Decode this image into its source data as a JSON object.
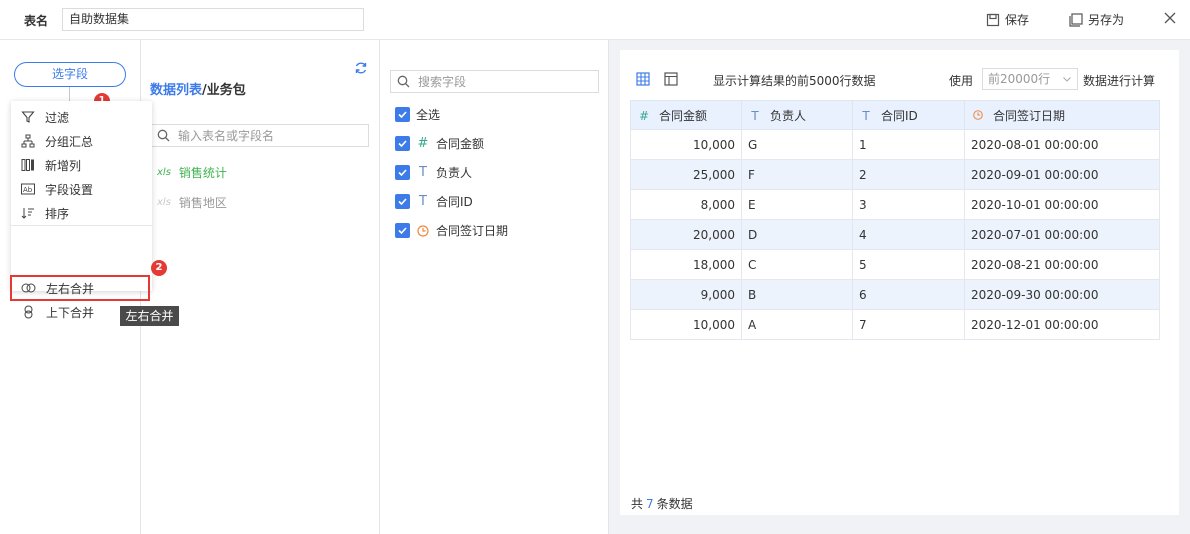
{
  "topbar": {
    "table_name_label": "表名",
    "table_name_value": "自助数据集",
    "save_label": "保存",
    "save_as_label": "另存为"
  },
  "left": {
    "select_field_label": "选字段",
    "plus_label": "+",
    "badge1": "1",
    "badge2": "2",
    "menu": [
      {
        "label": "过滤",
        "icon": "filter-icon"
      },
      {
        "label": "分组汇总",
        "icon": "group-icon"
      },
      {
        "label": "新增列",
        "icon": "add-column-icon"
      },
      {
        "label": "字段设置",
        "icon": "field-settings-icon"
      },
      {
        "label": "排序",
        "icon": "sort-icon"
      },
      {
        "label": "左右合并",
        "icon": "merge-horizontal-icon"
      },
      {
        "label": "上下合并",
        "icon": "merge-vertical-icon"
      }
    ],
    "tooltip": "左右合并"
  },
  "datalist": {
    "title_highlight": "数据列表",
    "title_rest": "/业务包",
    "search_placeholder": "输入表名或字段名",
    "tables": [
      {
        "name": "销售统计",
        "active": true
      },
      {
        "name": "销售地区",
        "active": false
      }
    ],
    "xls_label": "xls"
  },
  "fields": {
    "search_placeholder": "搜索字段",
    "select_all": "全选",
    "items": [
      {
        "name": "合同金额",
        "type": "#"
      },
      {
        "name": "负责人",
        "type": "T"
      },
      {
        "name": "合同ID",
        "type": "T"
      },
      {
        "name": "合同签订日期",
        "type": "date"
      }
    ]
  },
  "preview": {
    "info_text": "显示计算结果的前5000行数据",
    "use_label": "使用",
    "rows_select": "前20000行",
    "compute_label": "数据进行计算",
    "columns": [
      {
        "name": "合同金额",
        "type": "#"
      },
      {
        "name": "负责人",
        "type": "T"
      },
      {
        "name": "合同ID",
        "type": "T"
      },
      {
        "name": "合同签订日期",
        "type": "date"
      }
    ],
    "rows": [
      [
        "10,000",
        "G",
        "1",
        "2020-08-01 00:00:00"
      ],
      [
        "25,000",
        "F",
        "2",
        "2020-09-01 00:00:00"
      ],
      [
        "8,000",
        "E",
        "3",
        "2020-10-01 00:00:00"
      ],
      [
        "20,000",
        "D",
        "4",
        "2020-07-01 00:00:00"
      ],
      [
        "18,000",
        "C",
        "5",
        "2020-08-21 00:00:00"
      ],
      [
        "9,000",
        "B",
        "6",
        "2020-09-30 00:00:00"
      ],
      [
        "10,000",
        "A",
        "7",
        "2020-12-01 00:00:00"
      ]
    ],
    "footer_prefix": "共",
    "footer_count": "7",
    "footer_suffix": "条数据"
  },
  "colors": {
    "accent": "#3d7ce8",
    "red": "#e53935",
    "date_icon": "#f0883e",
    "xls_green": "#3fb34f"
  }
}
